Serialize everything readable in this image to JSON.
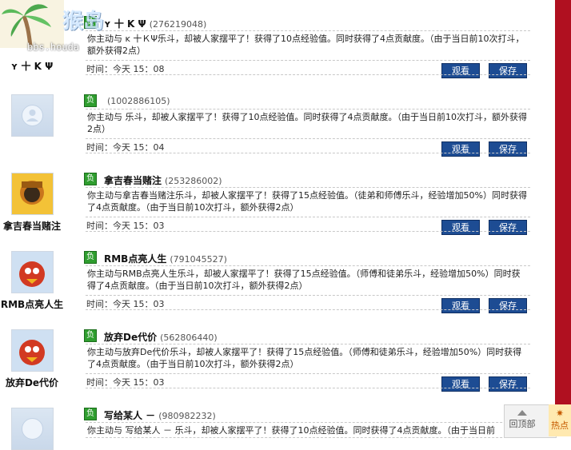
{
  "watermark": {
    "site": "bbs.houda",
    "logo_text": "猴岛"
  },
  "labels": {
    "watch": "观看",
    "save": "保存",
    "back_to_top": "回顶部",
    "hot": "热点"
  },
  "records": [
    {
      "avatar_name": "ʏ 十 K Ψ",
      "name": "ʏ 十 K Ψ",
      "uid": "(276219048)",
      "message": "你主动与 ᴋ 十ＫΨ乐斗，却被人家摆平了！获得了10点经验值。同时获得了4点贡献度。（由于当日前10次打斗，额外获得2点）",
      "time": "时间：今天 15：08"
    },
    {
      "avatar_name": "",
      "name": "",
      "uid": "(1002886105)",
      "message": "你主动与 乐斗，却被人家摆平了！获得了10点经验值。同时获得了4点贡献度。（由于当日前10次打斗，额外获得2点）",
      "time": "时间：今天 15：04"
    },
    {
      "avatar_name": "拿吉春当赌注",
      "name": "拿吉春当赌注",
      "uid": "(253286002)",
      "message": "你主动与拿吉春当赌注乐斗，却被人家摆平了！获得了15点经验值。（徒弟和师傅乐斗，经验增加50%）同时获得了4点贡献度。（由于当日前10次打斗，额外获得2点）",
      "time": "时间：今天 15：03"
    },
    {
      "avatar_name": "RMB点亮人生",
      "name": "RMB点亮人生",
      "uid": "(791045527)",
      "message": "你主动与RMB点亮人生乐斗，却被人家摆平了！获得了15点经验值。（师傅和徒弟乐斗，经验增加50%）同时获得了4点贡献度。（由于当日前10次打斗，额外获得2点）",
      "time": "时间：今天 15：03"
    },
    {
      "avatar_name": "放弃De代价",
      "name": "放弃De代价",
      "uid": "(562806440)",
      "message": "你主动与放弃De代价乐斗，却被人家摆平了！获得了15点经验值。（师傅和徒弟乐斗，经验增加50%）同时获得了4点贡献度。（由于当日前10次打斗，额外获得2点）",
      "time": "时间：今天 15：03"
    },
    {
      "avatar_name": "",
      "name": "写给某人 －",
      "uid": "(980982232)",
      "message": "你主动与 写给某人 － 乐斗，却被人家摆平了！获得了10点经验值。同时获得了4点贡献度。（由于当日前",
      "time": ""
    }
  ]
}
